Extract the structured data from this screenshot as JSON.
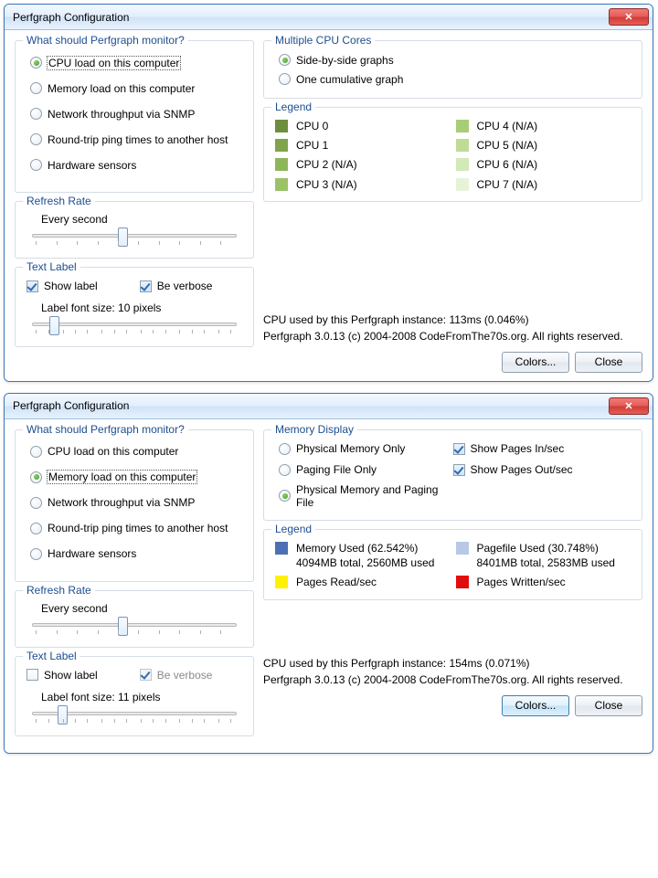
{
  "window_title": "Perfgraph Configuration",
  "monitor_box": {
    "title": "What should Perfgraph monitor?",
    "options": {
      "cpu": "CPU load on this computer",
      "memory": "Memory load on this computer",
      "network": "Network throughput via SNMP",
      "ping": "Round-trip ping times to another host",
      "hardware": "Hardware sensors"
    }
  },
  "refresh_box": {
    "title": "Refresh Rate",
    "label": "Every second"
  },
  "textlabel_box": {
    "title": "Text Label",
    "show": "Show label",
    "verbose": "Be verbose",
    "font1": "Label font size: 10 pixels",
    "font2": "Label font size: 11 pixels"
  },
  "cpu_cores_box": {
    "title": "Multiple CPU Cores",
    "side": "Side-by-side graphs",
    "cumulative": "One cumulative graph"
  },
  "legend_title": "Legend",
  "cpu_legend": [
    {
      "name": "CPU 0",
      "color": "#6d8e3d"
    },
    {
      "name": "CPU 4 (N/A)",
      "color": "#a9cd76"
    },
    {
      "name": "CPU 1",
      "color": "#7fa44c"
    },
    {
      "name": "CPU 5 (N/A)",
      "color": "#bedc97"
    },
    {
      "name": "CPU 2 (N/A)",
      "color": "#8db65a"
    },
    {
      "name": "CPU 6 (N/A)",
      "color": "#d2e9b8"
    },
    {
      "name": "CPU 3 (N/A)",
      "color": "#9cc267"
    },
    {
      "name": "CPU 7 (N/A)",
      "color": "#e6f3d9"
    }
  ],
  "memdisplay_box": {
    "title": "Memory Display",
    "phys": "Physical Memory Only",
    "paging": "Paging File Only",
    "both": "Physical Memory and Paging File",
    "in": "Show Pages In/sec",
    "out": "Show Pages Out/sec"
  },
  "mem_legend": {
    "used_title": "Memory Used (62.542%)",
    "used_sub": "4094MB total, 2560MB used",
    "pf_title": "Pagefile Used (30.748%)",
    "pf_sub": "8401MB total, 2583MB used",
    "pages_read": "Pages Read/sec",
    "pages_written": "Pages Written/sec"
  },
  "status1": "CPU used by this Perfgraph instance: 113ms (0.046%)",
  "status2": "CPU used by this Perfgraph instance: 154ms (0.071%)",
  "copyright": "Perfgraph 3.0.13 (c) 2004-2008 CodeFromThe70s.org. All rights reserved.",
  "buttons": {
    "colors": "Colors...",
    "close": "Close"
  }
}
